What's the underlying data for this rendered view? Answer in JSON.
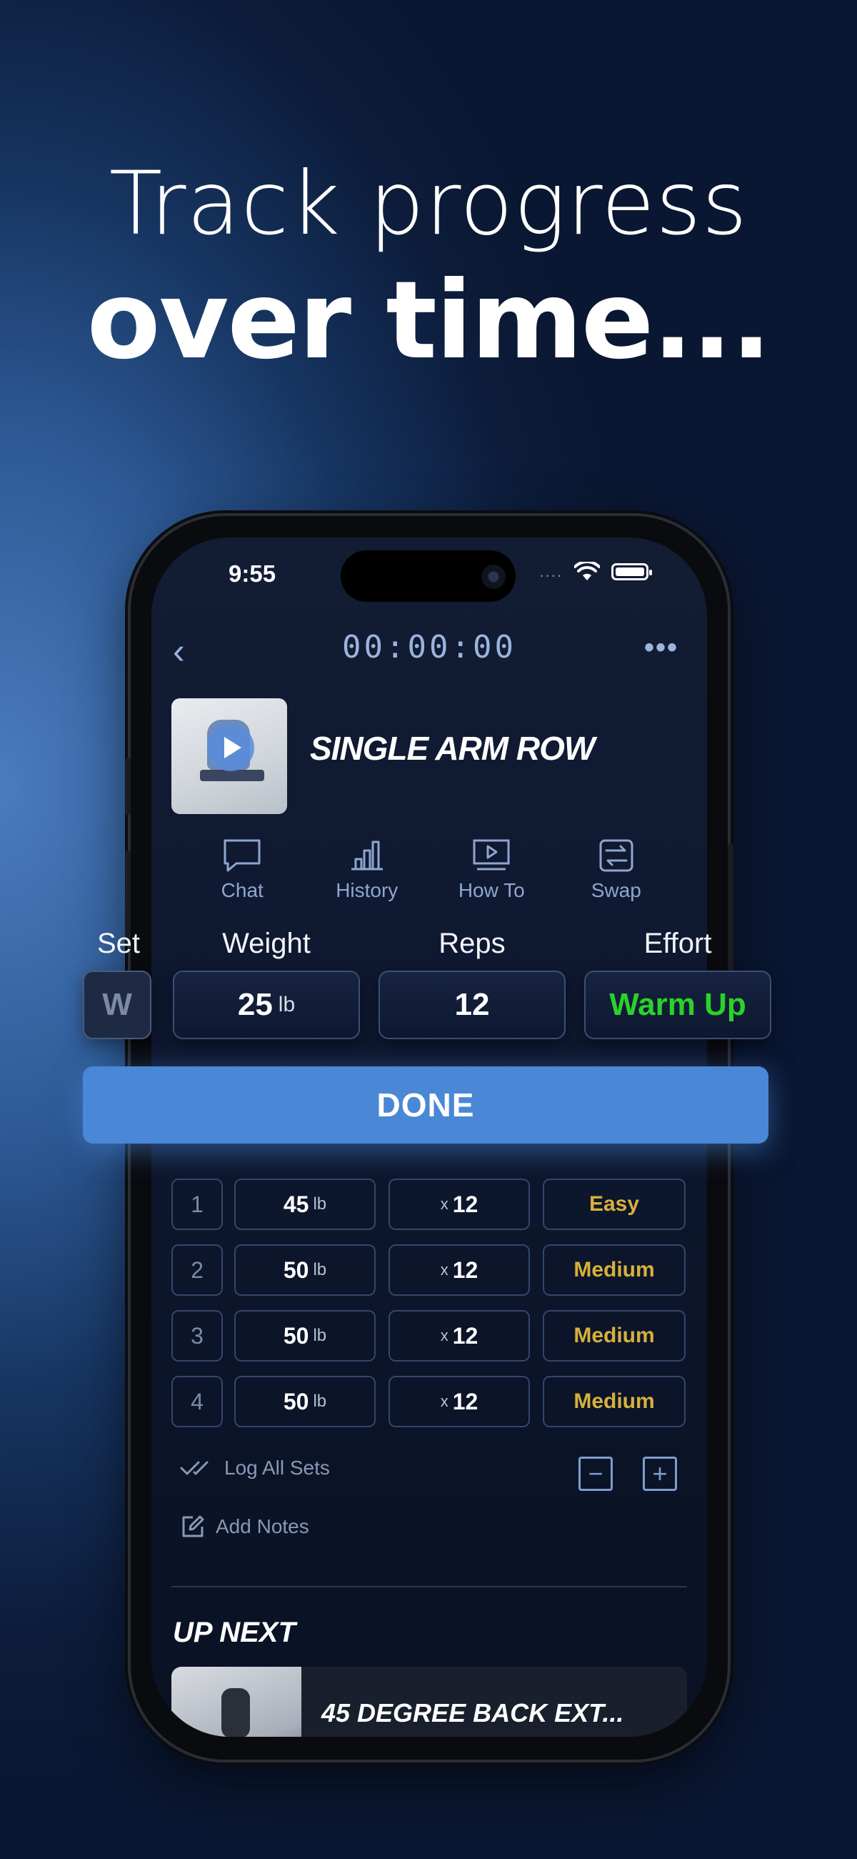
{
  "headline": {
    "line1": "Track progress",
    "line2": "over time..."
  },
  "status_bar": {
    "time": "9:55",
    "dots": "...."
  },
  "nav": {
    "back": "‹",
    "timer": "00:00:00",
    "more": "•••"
  },
  "exercise": {
    "title": "SINGLE ARM ROW"
  },
  "tools": [
    {
      "label": "Chat",
      "icon": "chat-icon"
    },
    {
      "label": "History",
      "icon": "history-icon"
    },
    {
      "label": "How To",
      "icon": "howto-icon"
    },
    {
      "label": "Swap",
      "icon": "swap-icon"
    }
  ],
  "current_set": {
    "headers": {
      "set": "Set",
      "weight": "Weight",
      "reps": "Reps",
      "effort": "Effort"
    },
    "set": "W",
    "weight": "25",
    "weight_unit": "lb",
    "reps": "12",
    "effort": "Warm Up",
    "done_label": "DONE"
  },
  "sets": [
    {
      "num": "1",
      "weight": "45",
      "unit": "lb",
      "x": "x",
      "reps": "12",
      "effort": "Easy"
    },
    {
      "num": "2",
      "weight": "50",
      "unit": "lb",
      "x": "x",
      "reps": "12",
      "effort": "Medium"
    },
    {
      "num": "3",
      "weight": "50",
      "unit": "lb",
      "x": "x",
      "reps": "12",
      "effort": "Medium"
    },
    {
      "num": "4",
      "weight": "50",
      "unit": "lb",
      "x": "x",
      "reps": "12",
      "effort": "Medium"
    }
  ],
  "actions": {
    "log_all": "Log All Sets",
    "add_notes": "Add Notes",
    "minus": "−",
    "plus": "+"
  },
  "up_next": {
    "heading": "UP NEXT",
    "title": "45 DEGREE BACK EXT..."
  },
  "colors": {
    "accent": "#4a87d6",
    "effort_warmup": "#2ad22a",
    "effort_other": "#d8b03a"
  }
}
